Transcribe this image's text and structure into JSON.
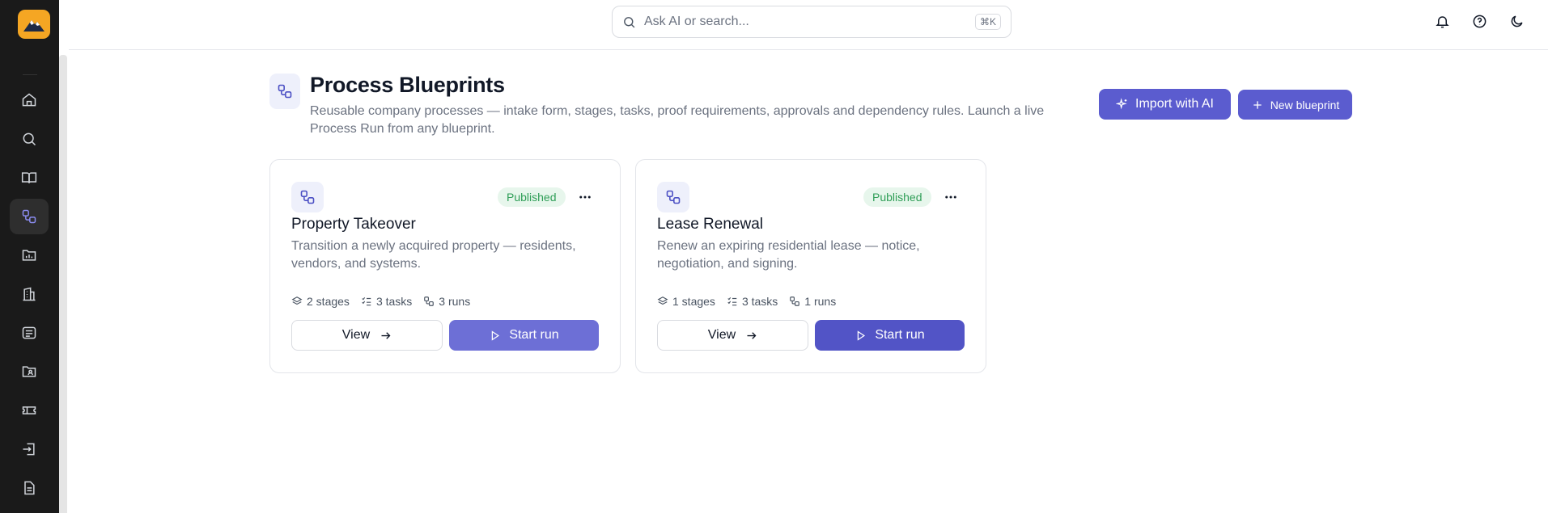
{
  "search": {
    "placeholder": "Ask AI or search...",
    "shortcut": "⌘K"
  },
  "header": {
    "title": "Process Blueprints",
    "description": "Reusable company processes — intake form, stages, tasks, proof requirements, approvals and dependency rules. Launch a live Process Run from any blueprint.",
    "import_label": "Import with AI",
    "new_label": "New blueprint"
  },
  "sidebar": {
    "items": [
      {
        "icon": "home-icon"
      },
      {
        "icon": "search-icon"
      },
      {
        "icon": "book-icon"
      },
      {
        "icon": "workflow-icon",
        "active": true
      },
      {
        "icon": "folder-chart-icon"
      },
      {
        "icon": "building-icon"
      },
      {
        "icon": "list-box-icon"
      },
      {
        "icon": "folder-user-icon"
      },
      {
        "icon": "ticket-icon"
      },
      {
        "icon": "sign-in-icon"
      },
      {
        "icon": "document-icon"
      }
    ]
  },
  "cards": [
    {
      "title": "Property Takeover",
      "description": "Transition a newly acquired property — residents, vendors, and systems.",
      "status": "Published",
      "stages": "2 stages",
      "tasks": "3 tasks",
      "runs": "3 runs",
      "view_label": "View",
      "start_label": "Start run"
    },
    {
      "title": "Lease Renewal",
      "description": "Renew an expiring residential lease — notice, negotiation, and signing.",
      "status": "Published",
      "stages": "1 stages",
      "tasks": "3 tasks",
      "runs": "1 runs",
      "view_label": "View",
      "start_label": "Start run"
    }
  ],
  "colors": {
    "accent": "#5b5ccf",
    "published_bg": "#e7f6ec",
    "published_fg": "#2f9e57",
    "sidebar_bg": "#1a1a1a",
    "logo": "#f5a623"
  }
}
